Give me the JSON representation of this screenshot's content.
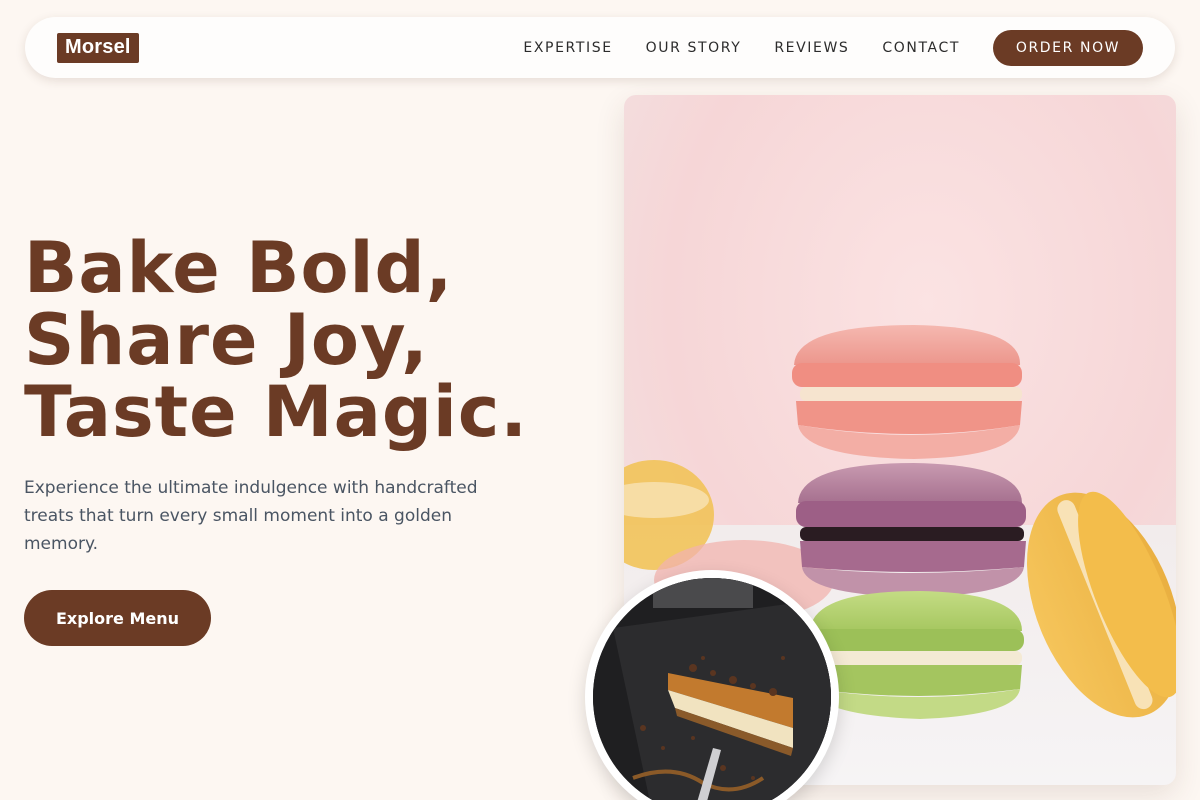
{
  "nav": {
    "logo": "Morsel",
    "links": [
      "EXPERTISE",
      "OUR STORY",
      "REVIEWS",
      "CONTACT"
    ],
    "cta": "ORDER NOW"
  },
  "hero": {
    "headline": [
      "Bake Bold,",
      "Share Joy,",
      "Taste Magic."
    ],
    "subtext": "Experience the ultimate indulgence with handcrafted treats that turn every small moment into a golden memory.",
    "button": "Explore Menu"
  },
  "images": {
    "main": "macaron-stack-photo",
    "circle": "cake-slice-photo"
  },
  "colors": {
    "brand": "#6b3b25",
    "background": "#fdf7f2",
    "body_text": "#4a5563"
  }
}
